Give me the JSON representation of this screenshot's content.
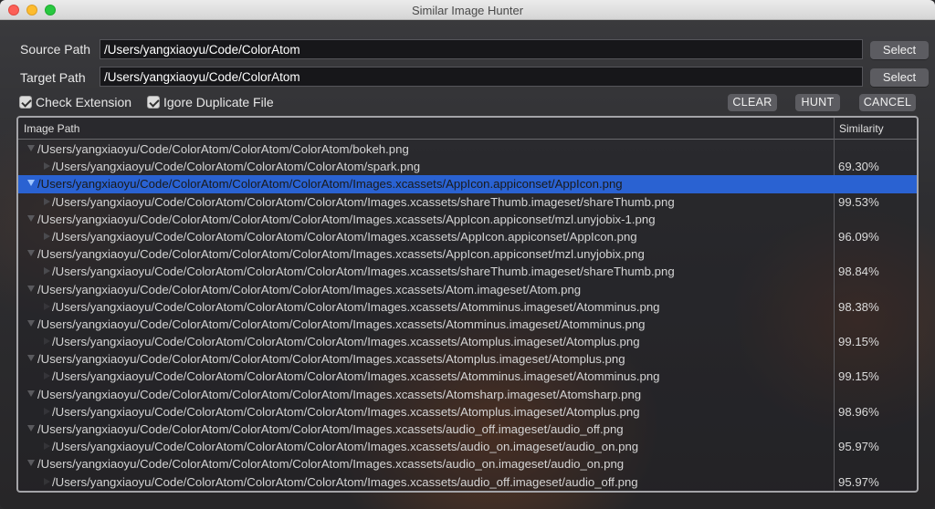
{
  "window": {
    "title": "Similar Image Hunter"
  },
  "source": {
    "label": "Source Path",
    "value": "/Users/yangxiaoyu/Code/ColorAtom",
    "button": "Select"
  },
  "target": {
    "label": "Target Path",
    "value": "/Users/yangxiaoyu/Code/ColorAtom",
    "button": "Select"
  },
  "options": {
    "check_extension": {
      "label": "Check Extension",
      "checked": true
    },
    "ignore_duplicate": {
      "label": "Igore Duplicate File",
      "checked": true
    }
  },
  "actions": {
    "clear": "CLEAR",
    "hunt": "HUNT",
    "cancel": "CANCEL"
  },
  "table": {
    "headers": {
      "path": "Image Path",
      "similarity": "Similarity"
    },
    "rows": [
      {
        "level": 0,
        "path": "/Users/yangxiaoyu/Code/ColorAtom/ColorAtom/ColorAtom/bokeh.png",
        "similarity": ""
      },
      {
        "level": 1,
        "path": "/Users/yangxiaoyu/Code/ColorAtom/ColorAtom/ColorAtom/spark.png",
        "similarity": "69.30%"
      },
      {
        "level": 0,
        "path": "/Users/yangxiaoyu/Code/ColorAtom/ColorAtom/ColorAtom/Images.xcassets/AppIcon.appiconset/AppIcon.png",
        "similarity": "",
        "selected": true
      },
      {
        "level": 1,
        "path": "/Users/yangxiaoyu/Code/ColorAtom/ColorAtom/ColorAtom/Images.xcassets/shareThumb.imageset/shareThumb.png",
        "similarity": "99.53%"
      },
      {
        "level": 0,
        "path": "/Users/yangxiaoyu/Code/ColorAtom/ColorAtom/ColorAtom/Images.xcassets/AppIcon.appiconset/mzl.unyjobix-1.png",
        "similarity": ""
      },
      {
        "level": 1,
        "path": "/Users/yangxiaoyu/Code/ColorAtom/ColorAtom/ColorAtom/Images.xcassets/AppIcon.appiconset/AppIcon.png",
        "similarity": "96.09%"
      },
      {
        "level": 0,
        "path": "/Users/yangxiaoyu/Code/ColorAtom/ColorAtom/ColorAtom/Images.xcassets/AppIcon.appiconset/mzl.unyjobix.png",
        "similarity": ""
      },
      {
        "level": 1,
        "path": "/Users/yangxiaoyu/Code/ColorAtom/ColorAtom/ColorAtom/Images.xcassets/shareThumb.imageset/shareThumb.png",
        "similarity": "98.84%"
      },
      {
        "level": 0,
        "path": "/Users/yangxiaoyu/Code/ColorAtom/ColorAtom/ColorAtom/Images.xcassets/Atom.imageset/Atom.png",
        "similarity": ""
      },
      {
        "level": 1,
        "path": "/Users/yangxiaoyu/Code/ColorAtom/ColorAtom/ColorAtom/Images.xcassets/Atomminus.imageset/Atomminus.png",
        "similarity": "98.38%"
      },
      {
        "level": 0,
        "path": "/Users/yangxiaoyu/Code/ColorAtom/ColorAtom/ColorAtom/Images.xcassets/Atomminus.imageset/Atomminus.png",
        "similarity": ""
      },
      {
        "level": 1,
        "path": "/Users/yangxiaoyu/Code/ColorAtom/ColorAtom/ColorAtom/Images.xcassets/Atomplus.imageset/Atomplus.png",
        "similarity": "99.15%"
      },
      {
        "level": 0,
        "path": "/Users/yangxiaoyu/Code/ColorAtom/ColorAtom/ColorAtom/Images.xcassets/Atomplus.imageset/Atomplus.png",
        "similarity": ""
      },
      {
        "level": 1,
        "path": "/Users/yangxiaoyu/Code/ColorAtom/ColorAtom/ColorAtom/Images.xcassets/Atomminus.imageset/Atomminus.png",
        "similarity": "99.15%"
      },
      {
        "level": 0,
        "path": "/Users/yangxiaoyu/Code/ColorAtom/ColorAtom/ColorAtom/Images.xcassets/Atomsharp.imageset/Atomsharp.png",
        "similarity": ""
      },
      {
        "level": 1,
        "path": "/Users/yangxiaoyu/Code/ColorAtom/ColorAtom/ColorAtom/Images.xcassets/Atomplus.imageset/Atomplus.png",
        "similarity": "98.96%"
      },
      {
        "level": 0,
        "path": "/Users/yangxiaoyu/Code/ColorAtom/ColorAtom/ColorAtom/Images.xcassets/audio_off.imageset/audio_off.png",
        "similarity": ""
      },
      {
        "level": 1,
        "path": "/Users/yangxiaoyu/Code/ColorAtom/ColorAtom/ColorAtom/Images.xcassets/audio_on.imageset/audio_on.png",
        "similarity": "95.97%"
      },
      {
        "level": 0,
        "path": "/Users/yangxiaoyu/Code/ColorAtom/ColorAtom/ColorAtom/Images.xcassets/audio_on.imageset/audio_on.png",
        "similarity": ""
      },
      {
        "level": 1,
        "path": "/Users/yangxiaoyu/Code/ColorAtom/ColorAtom/ColorAtom/Images.xcassets/audio_off.imageset/audio_off.png",
        "similarity": "95.97%"
      }
    ]
  },
  "colors": {
    "selection": "#2a62d2",
    "accent_brown": "#8c461e"
  }
}
